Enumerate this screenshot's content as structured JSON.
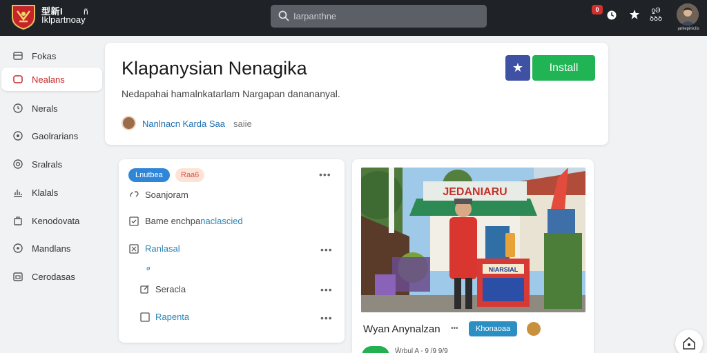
{
  "app": {
    "brand_line1": "型新I",
    "brand_line2": "Iklpartnoay",
    "brand_mark": "ñ"
  },
  "search": {
    "placeholder": "Iarpanthne"
  },
  "topbar": {
    "notif_count": "0",
    "top_count_line1": "ƍƏ",
    "top_count_line2": "ꝺꝺꝺ",
    "avatar_caption": "ꞁarkepiniclis"
  },
  "sidebar": {
    "items": [
      {
        "label": "Fokas",
        "icon": "box-icon"
      },
      {
        "label": "Nealans",
        "icon": "square-icon",
        "active": true
      },
      {
        "label": "Nerals",
        "icon": "clock-icon"
      },
      {
        "label": "Gaolrarians",
        "icon": "settings-icon"
      },
      {
        "label": "Sralrals",
        "icon": "target-icon"
      },
      {
        "label": "Klalals",
        "icon": "chart-icon"
      },
      {
        "label": "Kenodovata",
        "icon": "bag-icon"
      },
      {
        "label": "Mandlans",
        "icon": "circle-icon"
      },
      {
        "label": "Cerodasas",
        "icon": "calendar-icon"
      }
    ]
  },
  "header": {
    "title": "Klapanysian Nenagika",
    "description": "Nedapahai hamalnkatarlam Nargapan danananyal.",
    "author_name": "Nanlnacn Karda Saa",
    "author_suffix": "saiie",
    "star_label": "★",
    "install_label": "Install"
  },
  "list_card": {
    "chip_blue": "Lnutbea",
    "chip_peach": "Raa6",
    "more": "•••",
    "rows": [
      {
        "label": "Soanjoram",
        "icon": "link-icon",
        "link": false
      },
      {
        "label": "Bame enchpanaclascied",
        "icon": "checkbox-icon",
        "link": false,
        "trail": "Bame enchpa",
        "trail_link": "naclascied"
      },
      {
        "label": "Ranlasal",
        "icon": "checkbox-icon",
        "link": true
      },
      {
        "label": "Seracla",
        "icon": "edit-icon",
        "link": false
      },
      {
        "label": "Rapenta",
        "icon": "square-icon",
        "link": true
      }
    ],
    "sub_mark": "ø"
  },
  "image_card": {
    "sign_text": "JEDANIARU",
    "box_text": "NIARSIAL",
    "caption": "Wyan Anynalzan",
    "caption_dots": "•••",
    "chip": "Khonaoaa",
    "bottom_meta": "Ŵrbul A - 9 /9 9/9"
  },
  "colors": {
    "topbar": "#1f2328",
    "active_red": "#c62828",
    "install_green": "#20b455",
    "star_blue": "#3f51a3",
    "chip_blue": "#2f86d9",
    "link_blue": "#2a86b8"
  }
}
